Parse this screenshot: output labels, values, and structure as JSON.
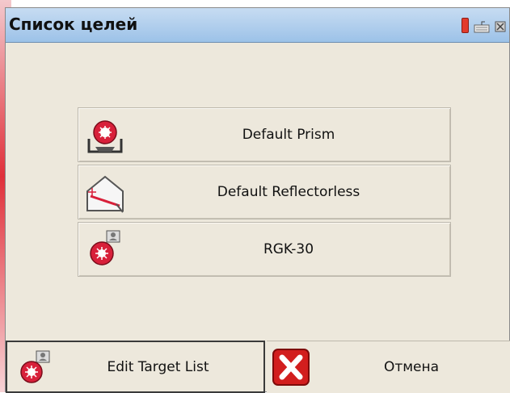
{
  "window": {
    "title": "Список целей",
    "tray_icons": [
      "battery-icon",
      "keyboard-icon",
      "signal-icon"
    ]
  },
  "targets": [
    {
      "label": "Default Prism",
      "icon": "prism-icon"
    },
    {
      "label": "Default Reflectorless",
      "icon": "reflectorless-icon"
    },
    {
      "label": "RGK-30",
      "icon": "custom-prism-icon"
    }
  ],
  "footer": {
    "edit_label": "Edit Target List",
    "cancel_label": "Отмена"
  },
  "colors": {
    "titlebar": "#9cc2e8",
    "panel": "#ede8dc",
    "prism_red": "#d8203a",
    "cancel_red": "#d21e1e"
  }
}
